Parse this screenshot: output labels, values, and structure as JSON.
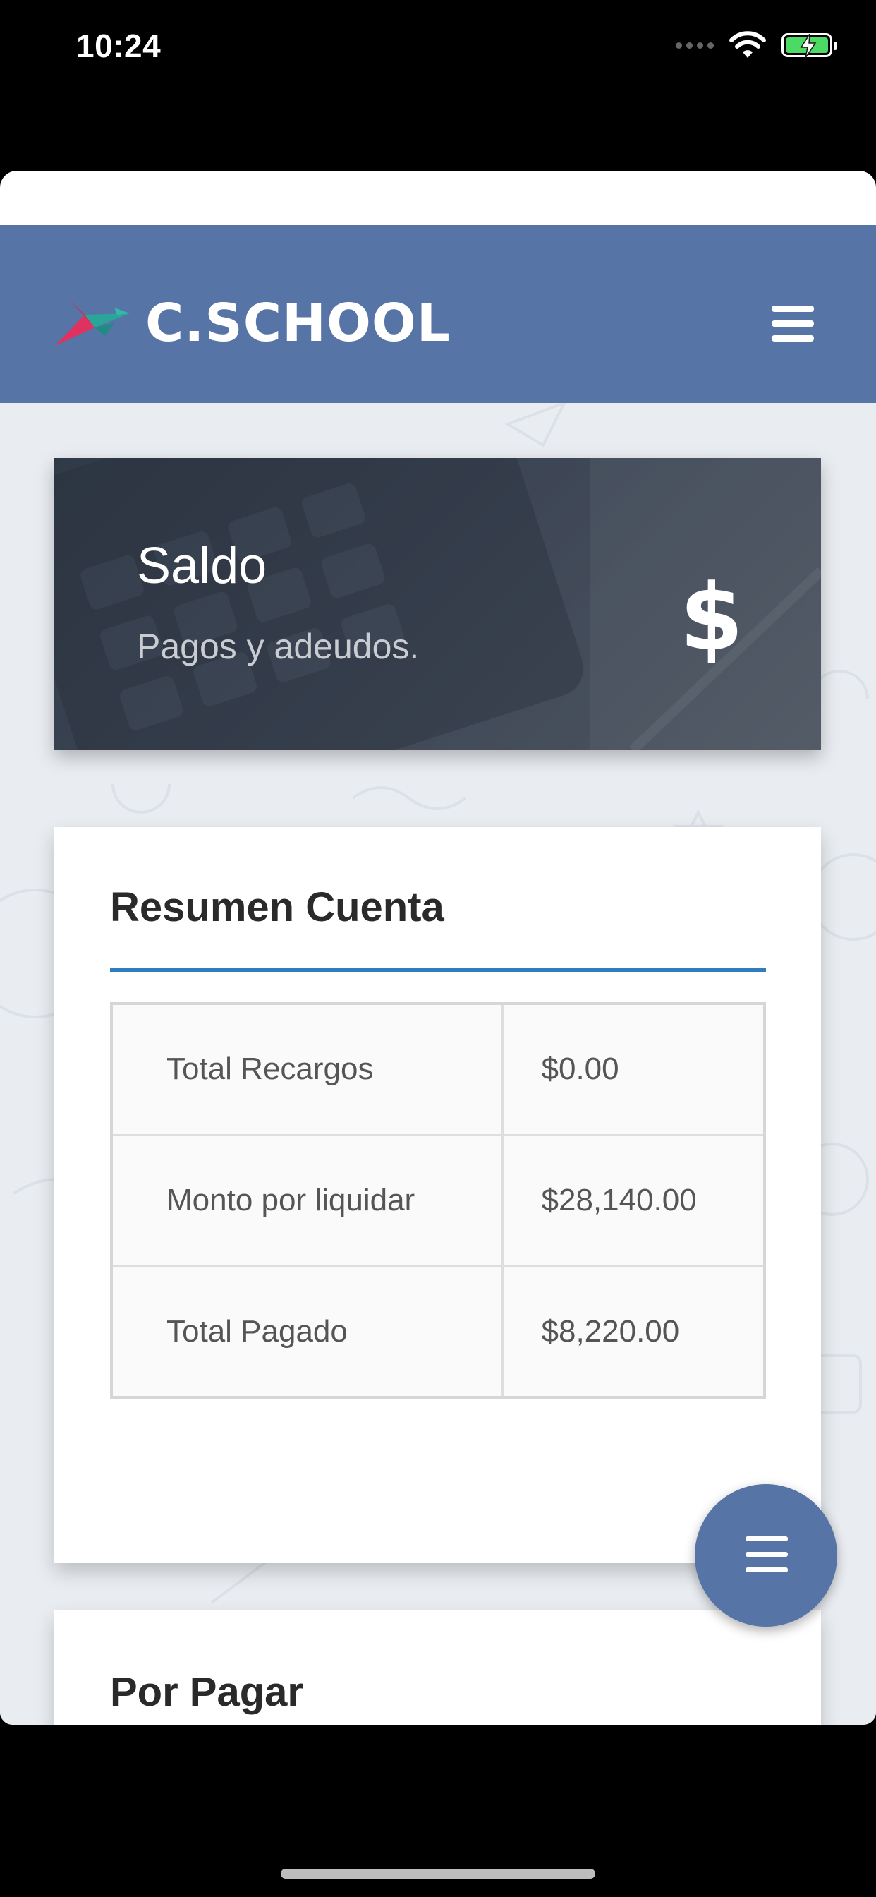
{
  "status_bar": {
    "time": "10:24"
  },
  "header": {
    "logo_text": "C.SCHOOL"
  },
  "banner": {
    "title": "Saldo",
    "subtitle": "Pagos y adeudos.",
    "icon_glyph": "$"
  },
  "summary": {
    "title": "Resumen Cuenta",
    "rows": [
      {
        "label": "Total Recargos",
        "value": "$0.00"
      },
      {
        "label": "Monto por liquidar",
        "value": "$28,140.00"
      },
      {
        "label": "Total Pagado",
        "value": "$8,220.00"
      }
    ]
  },
  "pending": {
    "title": "Por Pagar"
  },
  "colors": {
    "brand": "#5674a5",
    "accent_rule": "#2f7cbf",
    "battery": "#4cd964"
  }
}
